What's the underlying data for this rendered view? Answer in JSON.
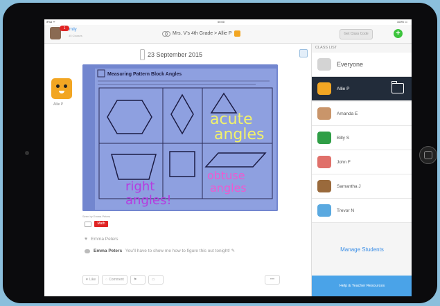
{
  "status": {
    "carrier": "iPad ᯤ",
    "time": "00:00",
    "battery": "100% ▭"
  },
  "nav": {
    "notification_badge": "1",
    "user_name": "mily",
    "user_sub": "35 Classes",
    "breadcrumb": "Mrs. V's 4th Grade > Allie P",
    "class_code_label": "Get Class Code",
    "add_label": "+"
  },
  "feed": {
    "date": "23 September 2015",
    "student_name": "Allie P",
    "worksheet_title": "Measuring Pattern Block Angles",
    "annotations": {
      "acute": [
        "acute",
        "angles"
      ],
      "obtuse": [
        "obtuse",
        "angles"
      ],
      "right": [
        "right",
        "angles!"
      ]
    },
    "photo_credit": "Seen by Emma Peters",
    "tag": "Math",
    "like_name": "Emma Peters",
    "comment_author": "Emma Peters",
    "comment_text": "You'll have to show me how to figure this out tonight! ✎",
    "actions": {
      "like": "Like",
      "comment": "Comment",
      "more": "•••"
    }
  },
  "sidebar": {
    "header": "CLASS LIST",
    "items": [
      {
        "label": "Everyone",
        "icon": "group-icon",
        "color": "#cfcfcf"
      },
      {
        "label": "Allie P",
        "icon": "tiger-icon",
        "color": "#f2a623"
      },
      {
        "label": "Amanda E",
        "icon": "dog-icon",
        "color": "#c9956a"
      },
      {
        "label": "Billy S",
        "icon": "dinosaur-icon",
        "color": "#2f9e46"
      },
      {
        "label": "John F",
        "icon": "octopus-icon",
        "color": "#e0706a"
      },
      {
        "label": "Samantha J",
        "icon": "horse-icon",
        "color": "#9a6a3c"
      },
      {
        "label": "Trevor N",
        "icon": "whale-icon",
        "color": "#5aa9e0"
      }
    ],
    "manage_label": "Manage Students",
    "help_label": "Help & Teacher Resources"
  }
}
